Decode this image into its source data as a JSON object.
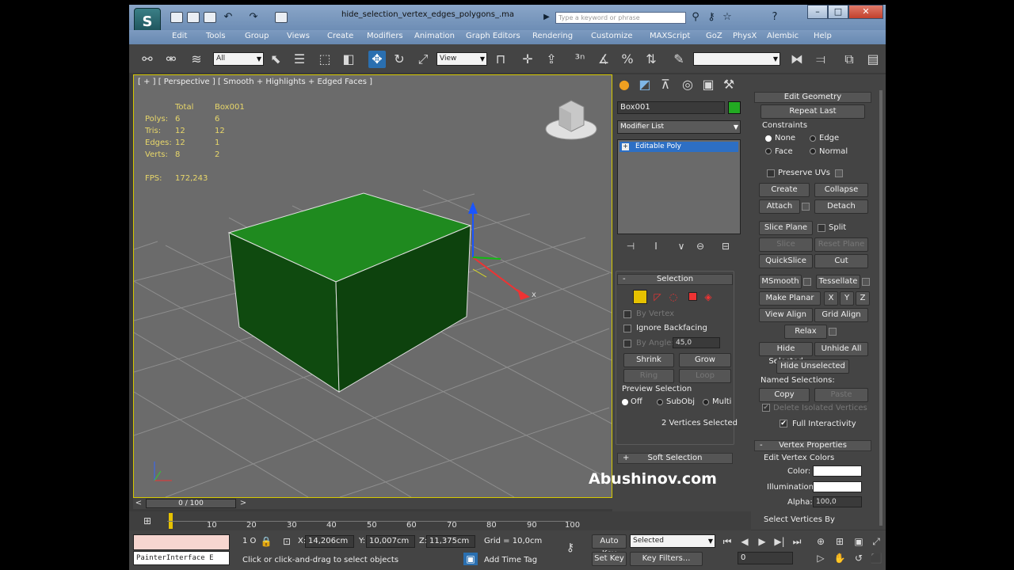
{
  "window": {
    "logo": "S",
    "title": "hide_selection_vertex_edges_polygons_.max",
    "search_placeholder": "Type a keyword or phrase",
    "controls": [
      "–",
      "□",
      "✕"
    ]
  },
  "menu": [
    "Edit",
    "Tools",
    "Group",
    "Views",
    "Create",
    "Modifiers",
    "Animation",
    "Graph Editors",
    "Rendering",
    "Customize",
    "MAXScript",
    "GoZ",
    "PhysX",
    "Alembic",
    "Help"
  ],
  "toolbar": {
    "filter_value": "All",
    "ref_coord_value": "View"
  },
  "viewport": {
    "label": "[ + ] [ Perspective ] [ Smooth + Highlights + Edged Faces ]",
    "stats": {
      "header_total": "Total",
      "header_obj": "Box001",
      "rows": [
        {
          "name": "Polys:",
          "total": "6",
          "obj": "6"
        },
        {
          "name": "Tris:",
          "total": "12",
          "obj": "12"
        },
        {
          "name": "Edges:",
          "total": "12",
          "obj": "1"
        },
        {
          "name": "Verts:",
          "total": "8",
          "obj": "2"
        }
      ],
      "fps_label": "FPS:",
      "fps_value": "172,243"
    },
    "gizmo_x": "x",
    "colors": {
      "face_top": "#1f8a1f",
      "face_front": "#0f4a0f",
      "face_side": "#0d420d",
      "grid": "#9a9a9a",
      "bg": "#6b6b6b"
    }
  },
  "command_panel": {
    "object_name": "Box001",
    "object_color": "#22aa22",
    "modifier_list": "Modifier List",
    "stack_item": "Editable Poly",
    "selection": {
      "header": "Selection",
      "by_vertex": "By Vertex",
      "ignore_backfacing": "Ignore Backfacing",
      "by_angle": "By Angle:",
      "angle_value": "45,0",
      "shrink": "Shrink",
      "grow": "Grow",
      "ring": "Ring",
      "loop": "Loop",
      "preview_selection": "Preview Selection",
      "preview_off": "Off",
      "preview_subobj": "SubObj",
      "preview_multi": "Multi",
      "status": "2 Vertices Selected"
    },
    "soft_selection": "Soft Selection"
  },
  "edit_geometry": {
    "header": "Edit Geometry",
    "repeat_last": "Repeat Last",
    "constraints": "Constraints",
    "c_none": "None",
    "c_edge": "Edge",
    "c_face": "Face",
    "c_normal": "Normal",
    "preserve_uvs": "Preserve UVs",
    "create": "Create",
    "collapse": "Collapse",
    "attach": "Attach",
    "detach": "Detach",
    "slice_plane": "Slice Plane",
    "split": "Split",
    "slice": "Slice",
    "reset_plane": "Reset Plane",
    "quickslice": "QuickSlice",
    "cut": "Cut",
    "msmooth": "MSmooth",
    "tessellate": "Tessellate",
    "make_planar": "Make Planar",
    "x": "X",
    "y": "Y",
    "z": "Z",
    "view_align": "View Align",
    "grid_align": "Grid Align",
    "relax": "Relax",
    "hide_selected": "Hide Selected",
    "unhide_all": "Unhide All",
    "hide_unselected": "Hide Unselected",
    "named_selections": "Named Selections:",
    "copy": "Copy",
    "paste": "Paste",
    "delete_isolated": "Delete Isolated Vertices",
    "full_interactivity": "Full Interactivity"
  },
  "vertex_properties": {
    "header": "Vertex Properties",
    "edit_vertex_colors": "Edit Vertex Colors",
    "color_label": "Color:",
    "illumination_label": "Illumination:",
    "alpha_label": "Alpha:",
    "alpha_value": "100,0",
    "select_vertices_by": "Select Vertices By"
  },
  "timeline": {
    "frame_counter": "0 / 100",
    "ticks": [
      "10",
      "20",
      "30",
      "40",
      "50",
      "60",
      "70",
      "80",
      "90",
      "100"
    ]
  },
  "status": {
    "maxscript": "PainterInterface E",
    "selection_count": "1 O",
    "x_label": "X:",
    "x_value": "14,206cm",
    "y_label": "Y:",
    "y_value": "10,007cm",
    "z_label": "Z:",
    "z_value": "11,375cm",
    "grid": "Grid = 10,0cm",
    "prompt": "Click or click-and-drag to select objects",
    "add_time_tag": "Add Time Tag",
    "auto_key": "Auto Key",
    "set_key": "Set Key",
    "key_mode": "Selected",
    "key_filters": "Key Filters...",
    "frame_value": "0"
  },
  "watermark": "Abushinov.com"
}
